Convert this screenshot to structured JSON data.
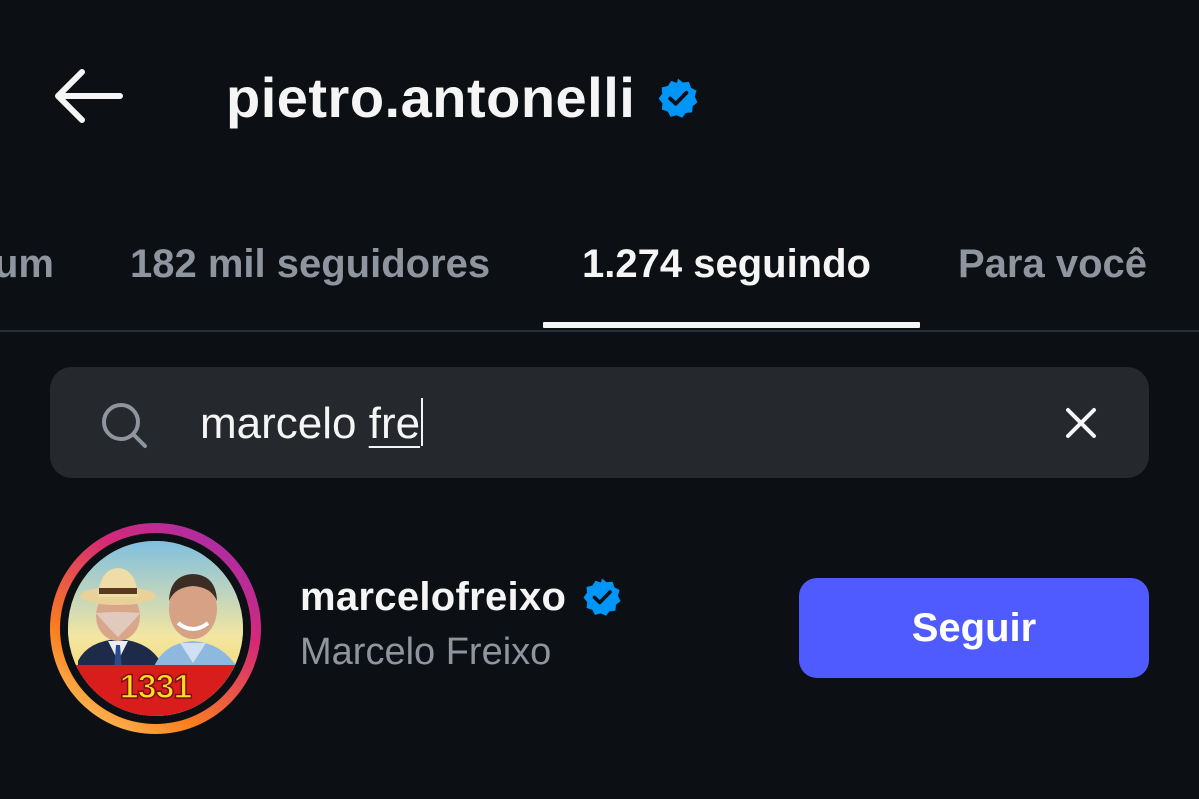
{
  "header": {
    "back_icon": "arrow-left-icon",
    "username": "pietro.antonelli",
    "verified_icon": "verified-badge-icon",
    "verified_color": "#0095f6"
  },
  "tabs": [
    {
      "label": "um",
      "active": false
    },
    {
      "label": "182 mil seguidores",
      "active": false
    },
    {
      "label": "1.274 seguindo",
      "active": true
    },
    {
      "label": "Para você",
      "active": false
    }
  ],
  "search": {
    "icon": "search-icon",
    "value_plain": "marcelo ",
    "value_composing": "fre",
    "clear_icon": "close-icon"
  },
  "results": [
    {
      "username": "marcelofreixo",
      "full_name": "Marcelo Freixo",
      "verified": true,
      "avatar_badge_text": "1331",
      "follow_label": "Seguir"
    }
  ],
  "colors": {
    "background": "#0c1014",
    "text_primary": "#f5f5f5",
    "text_secondary": "#8e959e",
    "search_background": "#25292e",
    "follow_button": "#4f5bff"
  }
}
